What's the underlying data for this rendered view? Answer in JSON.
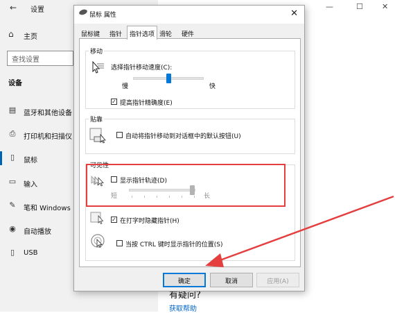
{
  "settings": {
    "title": "设置",
    "home_label": "主页",
    "search_placeholder": "查找设置",
    "section_title": "设备",
    "nav": [
      {
        "label": "蓝牙和其他设备",
        "icon": "bluetooth-devices-icon"
      },
      {
        "label": "打印机和扫描仪",
        "icon": "printer-icon"
      },
      {
        "label": "鼠标",
        "icon": "mouse-icon",
        "active": true
      },
      {
        "label": "输入",
        "icon": "keyboard-icon"
      },
      {
        "label": "笔和 Windows Ink",
        "icon": "pen-icon"
      },
      {
        "label": "自动播放",
        "icon": "autoplay-icon"
      },
      {
        "label": "USB",
        "icon": "usb-icon"
      }
    ],
    "window_controls": [
      "—",
      "☐",
      "✕"
    ],
    "help_heading": "有疑问?",
    "help_link": "获取帮助"
  },
  "dialog": {
    "title": "鼠标 属性",
    "close": "✕",
    "tabs": [
      {
        "label": "鼠标键"
      },
      {
        "label": "指针"
      },
      {
        "label": "指针选项",
        "active": true
      },
      {
        "label": "滑轮"
      },
      {
        "label": "硬件"
      }
    ],
    "motion": {
      "group": "移动",
      "speed_label": "选择指针移动速度(C):",
      "slow": "慢",
      "fast": "快",
      "speed_value": 0.5,
      "precision_label": "提高指针精确度(E)",
      "precision_checked": true
    },
    "snap": {
      "group": "贴靠",
      "label": "自动将指针移动到对话框中的默认按钮(U)",
      "checked": false
    },
    "visibility": {
      "group": "可见性",
      "trails_label": "显示指针轨迹(D)",
      "trails_checked": false,
      "short": "短",
      "long": "长",
      "trails_value": 0.95,
      "hide_label": "在打字时隐藏指针(H)",
      "hide_checked": true,
      "ctrl_label": "当按 CTRL 键时显示指针的位置(S)",
      "ctrl_checked": false
    },
    "buttons": {
      "ok": "确定",
      "cancel": "取消",
      "apply": "应用(A)"
    }
  },
  "colors": {
    "accent": "#0078d7",
    "annotation": "#e53e3e"
  }
}
